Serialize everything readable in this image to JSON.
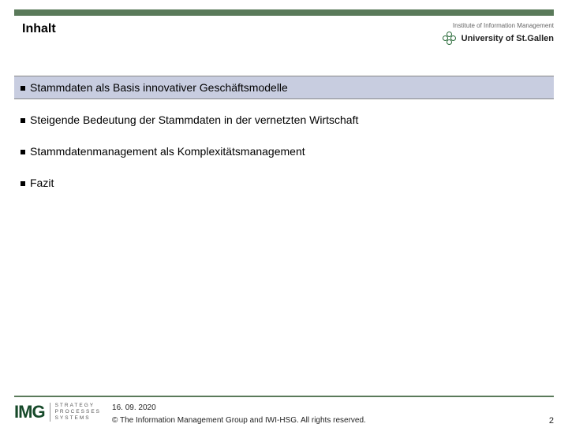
{
  "header": {
    "title": "Inhalt",
    "institute_label": "Institute of Information Management",
    "university_name": "University of St.Gallen"
  },
  "agenda": [
    {
      "text": "Stammdaten als Basis innovativer Geschäftsmodelle",
      "highlight": true
    },
    {
      "text": "Steigende Bedeutung der Stammdaten in der vernetzten Wirtschaft",
      "highlight": false
    },
    {
      "text": "Stammdatenmanagement als Komplexitätsmanagement",
      "highlight": false
    },
    {
      "text": "Fazit",
      "highlight": false
    }
  ],
  "footer": {
    "logo_mark": "IMG",
    "logo_tag_lines": [
      "STRATEGY",
      "PROCESSES",
      "SYSTEMS"
    ],
    "date": "16. 09. 2020",
    "copyright": "© The Information Management Group and IWI-HSG. All rights reserved.",
    "page": "2"
  }
}
